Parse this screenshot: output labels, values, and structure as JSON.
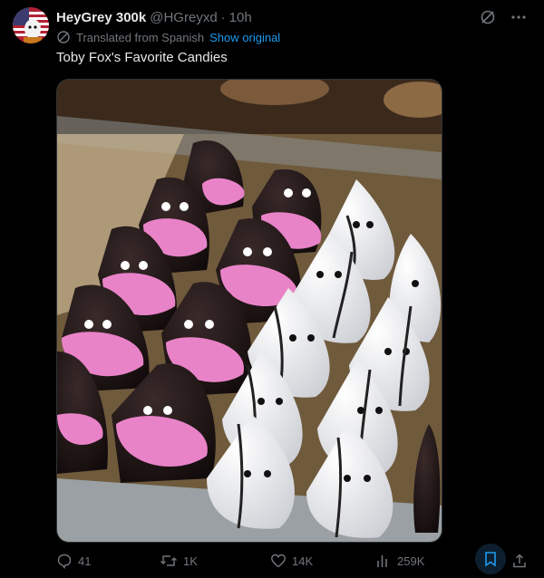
{
  "author": {
    "display_name": "HeyGrey 300k",
    "handle": "@HGreyxd",
    "separator": "·",
    "time": "10h"
  },
  "translation": {
    "note": "Translated from Spanish",
    "show_original": "Show original"
  },
  "text": "Toby Fox's Favorite Candies",
  "media": {
    "alt": "Candy display case with chocolate candies with pink lips and white candies with black dots"
  },
  "metrics": {
    "replies": "41",
    "reposts": "1K",
    "likes": "14K",
    "views": "259K"
  },
  "icons": [
    "avatar",
    "grok-icon",
    "more-icon",
    "translate-icon",
    "reply-icon",
    "repost-icon",
    "like-icon",
    "views-icon",
    "bookmark-icon",
    "share-icon"
  ],
  "colors": {
    "accent": "#1d9bf0",
    "muted": "#71767b",
    "text": "#e7e9ea",
    "background": "#000000"
  }
}
